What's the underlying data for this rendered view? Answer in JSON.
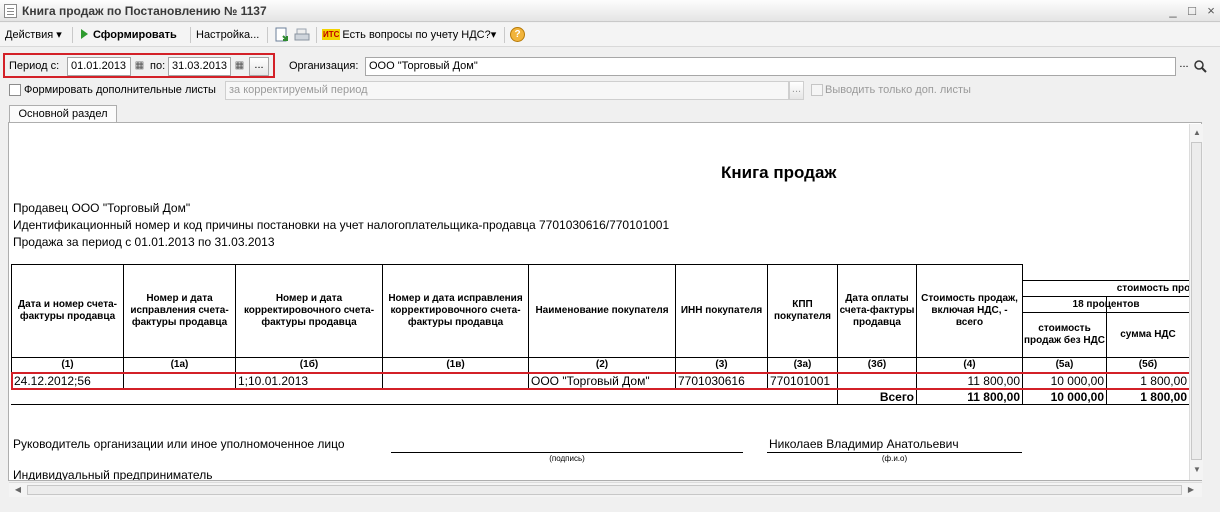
{
  "window": {
    "title": "Книга продаж по Постановлению № 1137",
    "controls": [
      "_",
      "□",
      "×"
    ]
  },
  "toolbar": {
    "actions_label": "Действия",
    "generate_label": "Сформировать",
    "settings_label": "Настройка...",
    "vat_questions_badge": "ИТС",
    "vat_questions_label": "Есть вопросы по учету НДС?",
    "help_label": "?"
  },
  "filters": {
    "period_from_label": "Период с:",
    "period_from": "01.01.2013",
    "period_to_label": "по:",
    "period_to": "31.03.2013",
    "period_select_label": "...",
    "organization_label": "Организация:",
    "organization": "ООО \"Торговый Дом\"",
    "organization_select_label": "...",
    "additional_sheets_label": "Формировать дополнительные листы",
    "corrected_period_placeholder": "за корректируемый период",
    "corrected_period_select_label": "...",
    "only_additional_label": "Выводить только доп. листы"
  },
  "tabs": [
    "Основной раздел"
  ],
  "report": {
    "title": "Книга продаж",
    "seller_line": "Продавец  ООО \"Торговый Дом\"",
    "inn_kpp_line": "Идентификационный номер и код причины постановки на учет налогоплательщика-продавца  7701030616/770101001",
    "period_line": "Продажа за период с 01.01.2013 по 31.03.2013",
    "columns": {
      "c1": "Дата и номер счета-фактуры продавца",
      "c1a": "Номер и дата исправления счета-фактуры продавца",
      "c1b": "Номер и дата корректировочного счета-фактуры продавца",
      "c1v": "Номер и дата исправления корректировочного счета-фактуры продавца",
      "c2": "Наименование покупателя",
      "c3": "ИНН покупателя",
      "c3a": "КПП покупателя",
      "c3b": "Дата оплаты счета-фактуры продавца",
      "c4": "Стоимость продаж, включая НДС, - всего",
      "group": "стоимость прода",
      "group18": "18 процентов",
      "c5a": "стоимость продаж без НДС",
      "c5b": "сумма НДС"
    },
    "column_numbers": [
      "(1)",
      "(1а)",
      "(1б)",
      "(1в)",
      "(2)",
      "(3)",
      "(3а)",
      "(3б)",
      "(4)",
      "(5а)",
      "(5б)"
    ],
    "rows": [
      {
        "c1": "24.12.2012;56",
        "c1a": "",
        "c1b": "1;10.01.2013",
        "c1v": "",
        "c2": "ООО \"Торговый Дом\"",
        "c3": "7701030616",
        "c3a": "770101001",
        "c3b": "",
        "c4": "11 800,00",
        "c5a": "10 000,00",
        "c5b": "1 800,00"
      }
    ],
    "total": {
      "label": "Всего",
      "c4": "11 800,00",
      "c5a": "10 000,00",
      "c5b": "1 800,00"
    },
    "signature": {
      "head_label": "Руководитель организации или иное уполномоченное лицо",
      "signature_caption": "(подпись)",
      "head_name": "Николаев Владимир Анатольевич",
      "name_caption": "(ф.и.о)",
      "entrepreneur_label": "Индивидуальный предприниматель"
    }
  },
  "colors": {
    "highlight": "#d32027",
    "generate_icon": "#2f9b2f"
  }
}
